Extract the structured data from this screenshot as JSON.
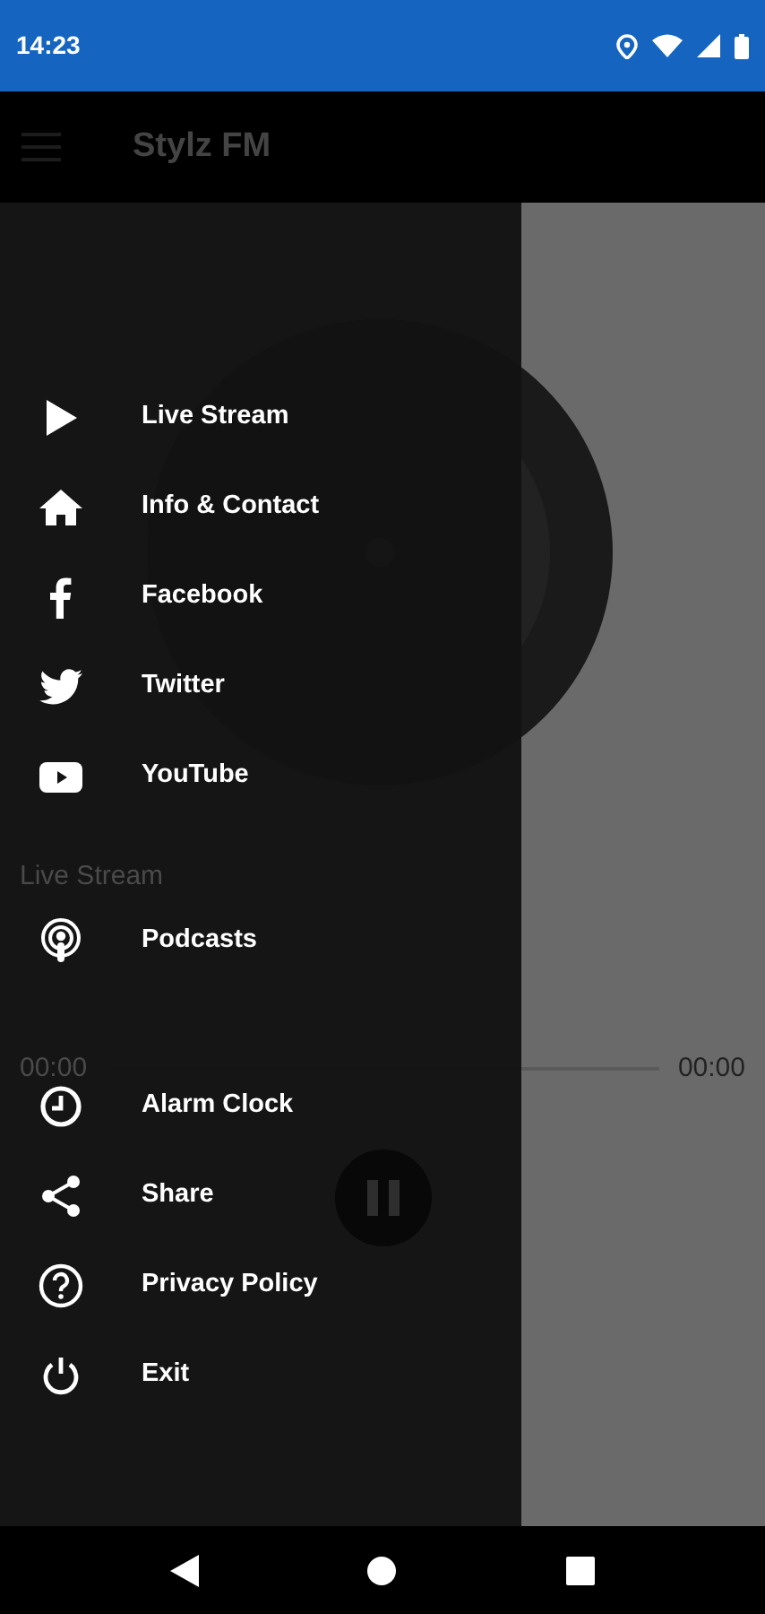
{
  "status_bar": {
    "time": "14:23"
  },
  "app_bar": {
    "title": "Stylz FM"
  },
  "player": {
    "station": "Live Stream",
    "elapsed": "00:00",
    "duration": "00:00"
  },
  "drawer": {
    "groups": [
      {
        "items": [
          {
            "label": "Live Stream"
          },
          {
            "label": "Info & Contact"
          },
          {
            "label": "Facebook"
          },
          {
            "label": "Twitter"
          },
          {
            "label": "YouTube"
          }
        ]
      },
      {
        "items": [
          {
            "label": "Podcasts"
          }
        ]
      },
      {
        "items": [
          {
            "label": "Alarm Clock"
          },
          {
            "label": "Share"
          },
          {
            "label": "Privacy Policy"
          },
          {
            "label": "Exit"
          }
        ]
      }
    ]
  }
}
